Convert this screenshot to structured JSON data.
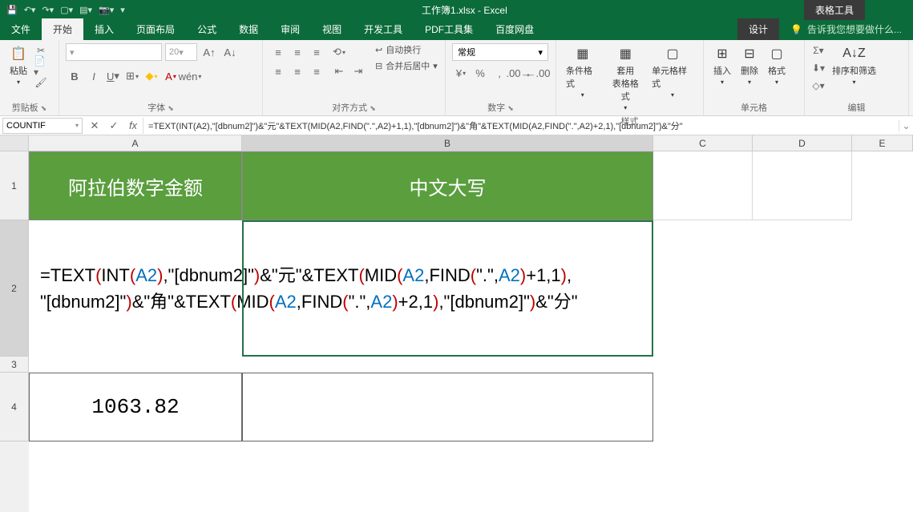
{
  "title": "工作簿1.xlsx - Excel",
  "tooltab": "表格工具",
  "tabs": {
    "file": "文件",
    "home": "开始",
    "insert": "插入",
    "layout": "页面布局",
    "formulas": "公式",
    "data": "数据",
    "review": "审阅",
    "view": "视图",
    "dev": "开发工具",
    "pdf": "PDF工具集",
    "baidu": "百度网盘",
    "design": "设计"
  },
  "tellme": "告诉我您想要做什么...",
  "ribbon": {
    "clipboard": {
      "label": "剪贴板",
      "paste": "粘贴"
    },
    "font": {
      "label": "字体",
      "size": "20"
    },
    "align": {
      "label": "对齐方式",
      "wrap": "自动换行",
      "merge": "合并后居中"
    },
    "number": {
      "label": "数字",
      "general": "常规"
    },
    "styles": {
      "label": "样式",
      "cond": "条件格式",
      "table": "套用\n表格格式",
      "cell": "单元格样式"
    },
    "cells": {
      "label": "单元格",
      "insert": "插入",
      "delete": "删除",
      "format": "格式"
    },
    "editing": {
      "label": "编辑",
      "sort": "排序和筛选"
    }
  },
  "namebox": "COUNTIF",
  "formula": "=TEXT(INT(A2),\"[dbnum2]\")&\"元\"&TEXT(MID(A2,FIND(\".\",A2)+1,1),\"[dbnum2]\")&\"角\"&TEXT(MID(A2,FIND(\".\",A2)+2,1),\"[dbnum2]\")&\"分\"",
  "cols": [
    "A",
    "B",
    "C",
    "D",
    "E"
  ],
  "rows": [
    "1",
    "2",
    "3",
    "4"
  ],
  "cells": {
    "a1": "阿拉伯数字金额",
    "b1": "中文大写",
    "a4": "1063.82"
  },
  "formula_display": {
    "line1_p1": "=TEXT",
    "line1_p2": "INT",
    "line1_p3": "A2",
    "line1_p4": ",\"[dbnum2]\"",
    "line1_p5": "&\"元\"&TEXT",
    "line1_p6": "MID",
    "line1_p7": "A2",
    "line1_p8": ",FIND",
    "line1_p9": "\".\",",
    "line1_p10": "A2",
    "line1_p11": "+1,1",
    "line1_p12": ",",
    "line2_p1": "\"[dbnum2]\"",
    "line2_p2": "&\"角\"&TEXT",
    "line2_p3": "MID",
    "line2_p4": "A2",
    "line2_p5": ",FIND",
    "line2_p6": "\".\",",
    "line2_p7": "A2",
    "line2_p8": "+2,1",
    "line2_p9": ",\"[dbnum2]\"",
    "line2_p10": "&\"分\""
  }
}
